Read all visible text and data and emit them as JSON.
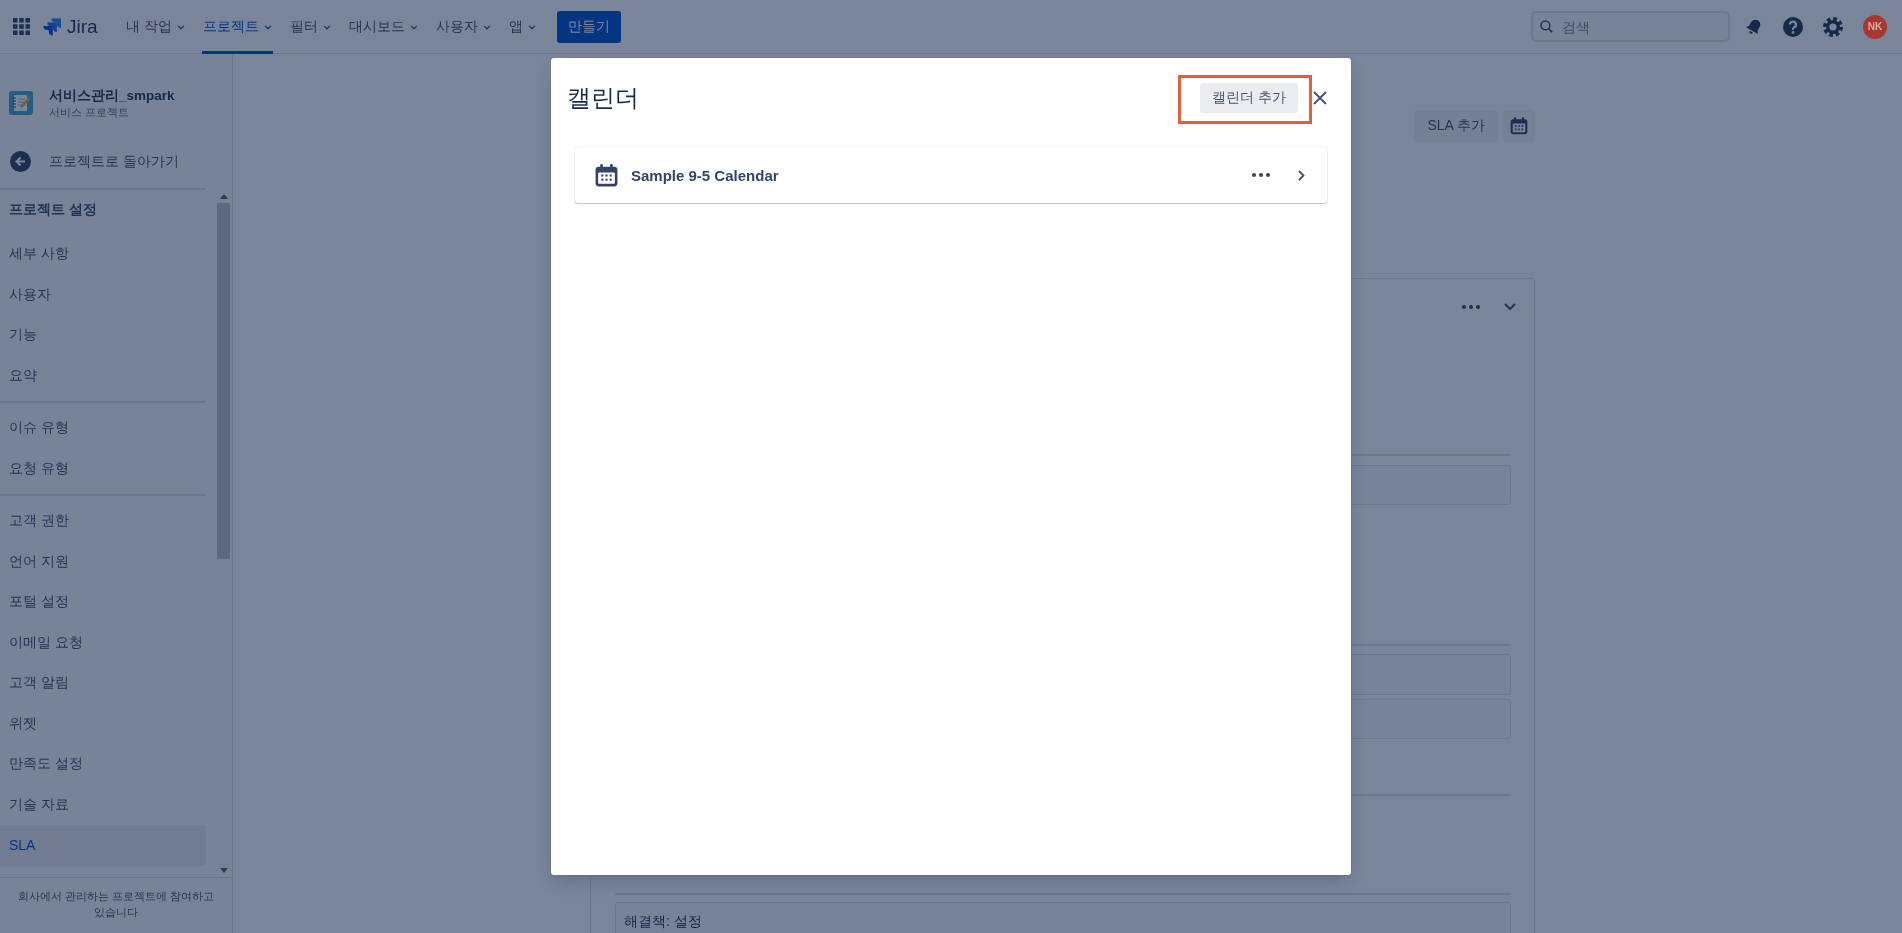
{
  "top_nav": {
    "product": "Jira",
    "menus": [
      {
        "label": "내 작업",
        "selected": false
      },
      {
        "label": "프로젝트",
        "selected": true
      },
      {
        "label": "필터",
        "selected": false
      },
      {
        "label": "대시보드",
        "selected": false
      },
      {
        "label": "사용자",
        "selected": false
      },
      {
        "label": "앱",
        "selected": false
      }
    ],
    "create_button": "만들기",
    "search": {
      "placeholder": "검색"
    },
    "avatar": "NK"
  },
  "sidebar": {
    "project": {
      "name": "서비스관리_smpark",
      "type": "서비스 프로젝트"
    },
    "back_link": "프로젝트로 돌아가기",
    "section_title": "프로젝트 설정",
    "groups": [
      {
        "items": [
          {
            "label": "세부 사항",
            "selected": false
          },
          {
            "label": "사용자",
            "selected": false
          },
          {
            "label": "기능",
            "selected": false
          },
          {
            "label": "요약",
            "selected": false
          }
        ]
      },
      {
        "items": [
          {
            "label": "이슈 유형",
            "selected": false
          },
          {
            "label": "요청 유형",
            "selected": false
          }
        ]
      },
      {
        "items": [
          {
            "label": "고객 권한",
            "selected": false
          },
          {
            "label": "언어 지원",
            "selected": false
          },
          {
            "label": "포털 설정",
            "selected": false
          },
          {
            "label": "이메일 요청",
            "selected": false
          },
          {
            "label": "고객 알림",
            "selected": false
          },
          {
            "label": "위젯",
            "selected": false
          },
          {
            "label": "만족도 설정",
            "selected": false
          },
          {
            "label": "기술 자료",
            "selected": false
          },
          {
            "label": "SLA",
            "selected": true
          }
        ]
      }
    ],
    "footer": "회사에서 관리하는 프로젝트에 참여하고 있습니다"
  },
  "main": {
    "add_sla_button": "SLA 추가",
    "condition_row": "해결책: 설정"
  },
  "modal": {
    "title": "캘린더",
    "add_button": {
      "label": "캘린더 추가",
      "highlighted": true
    },
    "calendars": [
      {
        "name": "Sample 9-5 Calendar"
      }
    ]
  }
}
